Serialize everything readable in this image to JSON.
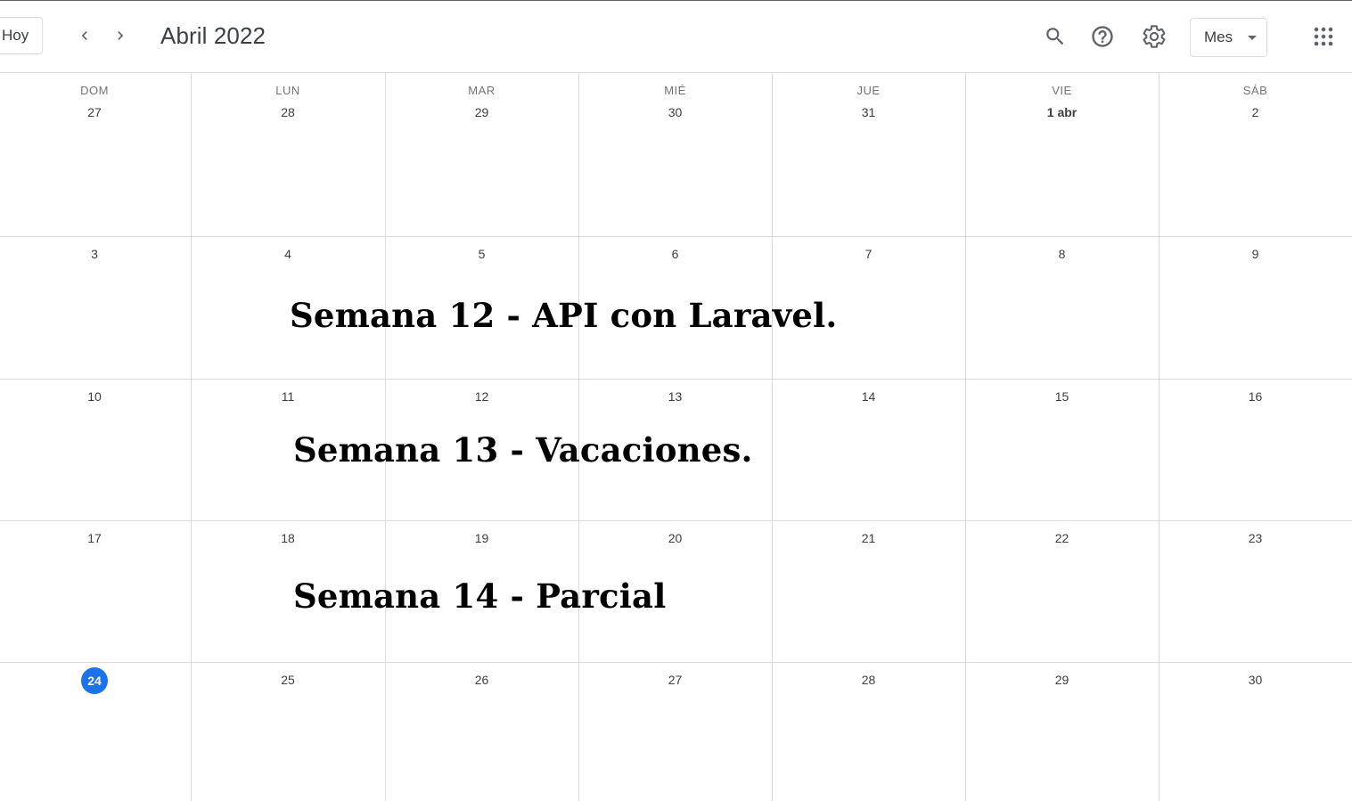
{
  "header": {
    "today_label": "Hoy",
    "title": "Abril 2022",
    "view_label": "Mes",
    "icons": [
      "chevron-left-icon",
      "chevron-right-icon",
      "search-icon",
      "help-icon",
      "gear-icon",
      "apps-grid-icon"
    ]
  },
  "weekdays": [
    "DOM",
    "LUN",
    "MAR",
    "MIÉ",
    "JUE",
    "VIE",
    "SÁB"
  ],
  "weeks": [
    [
      "27",
      "28",
      "29",
      "30",
      "31",
      "1 abr",
      "2"
    ],
    [
      "3",
      "4",
      "5",
      "6",
      "7",
      "8",
      "9"
    ],
    [
      "10",
      "11",
      "12",
      "13",
      "14",
      "15",
      "16"
    ],
    [
      "17",
      "18",
      "19",
      "20",
      "21",
      "22",
      "23"
    ],
    [
      "24",
      "25",
      "26",
      "27",
      "28",
      "29",
      "30"
    ]
  ],
  "today": "24",
  "overlays": [
    "Semana 12 - API con Laravel.",
    "Semana 13 - Vacaciones.",
    "Semana 14 - Parcial"
  ],
  "colors": {
    "accent": "#1a73e8",
    "grid": "#dadce0",
    "text": "#3c4043"
  }
}
